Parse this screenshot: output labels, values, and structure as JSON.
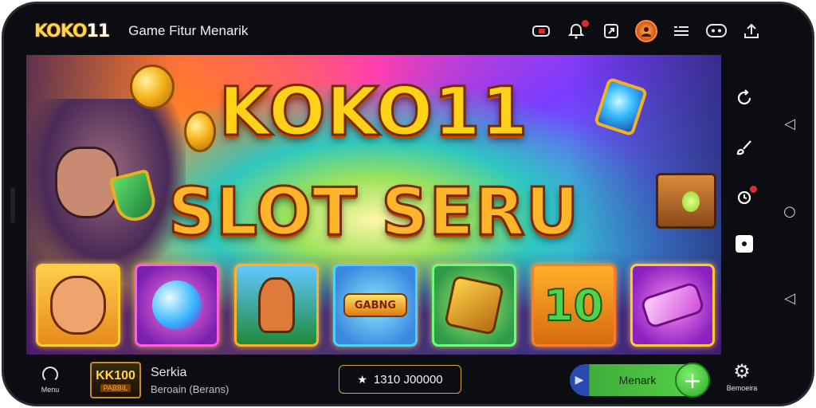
{
  "header": {
    "logo_main": "KOKO",
    "logo_num": "11",
    "title": "Game Fitur Menarik",
    "icons": [
      "video-icon",
      "notification-icon",
      "share-icon",
      "profile-avatar",
      "list-icon",
      "chat-icon",
      "upload-icon"
    ]
  },
  "banner": {
    "title_line1": "KOKO11",
    "title_line2": "SLOT SERU",
    "tiles": [
      {
        "name": "hero-face",
        "label": ""
      },
      {
        "name": "magic-orb",
        "label": ""
      },
      {
        "name": "jungle-fox",
        "label": ""
      },
      {
        "name": "gabng-logo",
        "label": "GABNG"
      },
      {
        "name": "treasure-cube",
        "label": ""
      },
      {
        "name": "number-10",
        "label": "10"
      },
      {
        "name": "crystal-bar",
        "label": ""
      }
    ]
  },
  "right_rail": {
    "icons": [
      "refresh-icon",
      "brush-icon",
      "alarm-icon",
      "record-icon"
    ]
  },
  "system_nav": {
    "back": "◁",
    "home": "○",
    "recent": "◁"
  },
  "bottom_bar": {
    "menu_label": "Menu",
    "thumb_top": "KK100",
    "thumb_bottom": "PABBIL",
    "game_name": "Serkia",
    "game_sub": "Beroain (Berans)",
    "jackpot_text": "1310 J00000",
    "cta_label": "Menark",
    "cta_plus": "+",
    "settings_label": "Bemoeira"
  },
  "colors": {
    "accent_gold": "#ffd21a",
    "cta_green": "#58d24a",
    "cta_blue": "#2a4ab0",
    "frame": "#0c0d12"
  }
}
